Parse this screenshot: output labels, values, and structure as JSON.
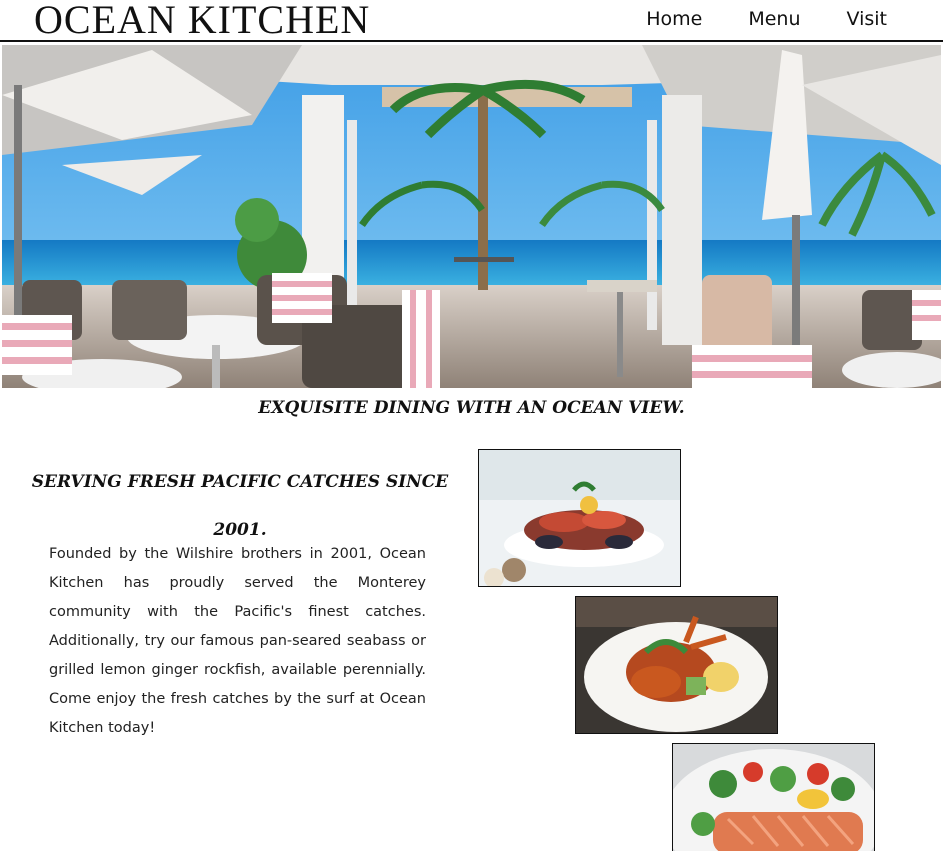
{
  "header": {
    "brand": "OCEAN KITCHEN",
    "nav": [
      {
        "label": "Home"
      },
      {
        "label": "Menu"
      },
      {
        "label": "Visit"
      }
    ]
  },
  "hero": {
    "icon": "restaurant-terrace-photo"
  },
  "tagline": "EXQUISITE DINING WITH AN OCEAN VIEW.",
  "about": {
    "title_line1": "SERVING FRESH PACIFIC CATCHES SINCE",
    "title_line2": "2001.",
    "text": "Founded by the Wilshire brothers in 2001, Ocean Kitchen has proudly served the Monterey community with the Pacific's finest catches. Additionally, try our famous pan-seared seabass or grilled lemon ginger rockfish, available perennially. Come enjoy the fresh catches by the surf at Ocean Kitchen today!"
  },
  "photos": [
    {
      "icon": "seafood-platter-photo"
    },
    {
      "icon": "lobster-dish-photo"
    },
    {
      "icon": "salmon-salad-photo"
    }
  ],
  "colors": {
    "sky": "#4aa8e8",
    "ocean": "#1f8fd0",
    "stripe_pink": "#e9a9b8",
    "text": "#111111"
  }
}
